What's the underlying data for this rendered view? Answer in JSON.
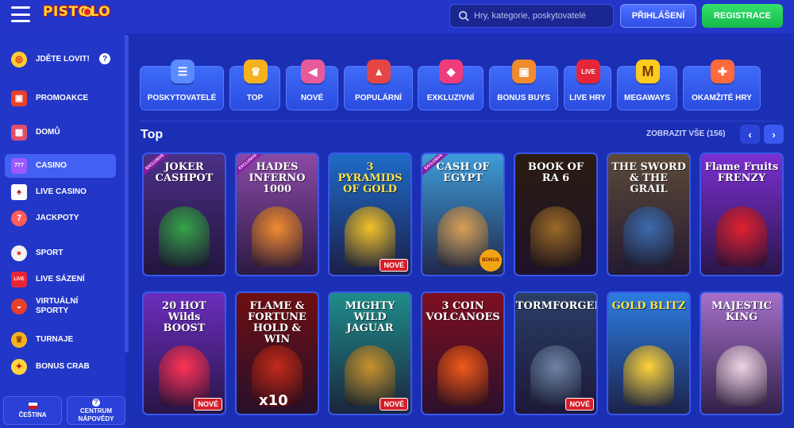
{
  "header": {
    "logo": "PISTOLO",
    "search_placeholder": "Hry, kategorie, poskytovatelé",
    "login_label": "PŘIHLÁŠENÍ",
    "register_label": "REGISTRACE"
  },
  "sidebar": {
    "items": [
      {
        "label": "JDĚTE LOVIT!",
        "icon": "target-icon",
        "color": "#ffcc33"
      },
      {
        "label": "PROMOAKCE",
        "icon": "gift-icon",
        "color": "#e8402b"
      },
      {
        "label": "DOMŮ",
        "icon": "slot-machine-icon",
        "color": "#e04f6a"
      },
      {
        "label": "CASINO",
        "icon": "casino-777-icon",
        "color": "#9b59ff"
      },
      {
        "label": "LIVE CASINO",
        "icon": "cards-icon",
        "color": "#ffffff"
      },
      {
        "label": "JACKPOTY",
        "icon": "jackpot-icon",
        "color": "#ff5c5c"
      },
      {
        "label": "SPORT",
        "icon": "ball-icon",
        "color": "#f2f2f2"
      },
      {
        "label": "LIVE SÁZENÍ",
        "icon": "live-icon",
        "color": "#e82538"
      },
      {
        "label": "VIRTUÁLNÍ SPORTY",
        "icon": "virtual-sports-icon",
        "color": "#e8402b"
      },
      {
        "label": "TURNAJE",
        "icon": "trophy-icon",
        "color": "#f5b21e"
      },
      {
        "label": "BONUS CRAB",
        "icon": "crab-icon",
        "color": "#ffd43d"
      }
    ],
    "language_label": "ČEŠTINA",
    "help_center_label": "CENTRUM NÁPOVĚDY"
  },
  "categories": [
    {
      "label": "POSKYTOVATELÉ",
      "icon": "providers-icon",
      "color": "#5a8bff"
    },
    {
      "label": "TOP",
      "icon": "crown-icon",
      "color": "#f5b21e"
    },
    {
      "label": "NOVÉ",
      "icon": "megaphone-icon",
      "color": "#e85a9b"
    },
    {
      "label": "POPULÁRNÍ",
      "icon": "rocket-icon",
      "color": "#e64545"
    },
    {
      "label": "EXKLUZIVNÍ",
      "icon": "diamond-icon",
      "color": "#f03c7a"
    },
    {
      "label": "BONUS BUYS",
      "icon": "gift-box-icon",
      "color": "#f08b2e"
    },
    {
      "label": "LIVE HRY",
      "icon": "live-tv-icon",
      "color": "#e82538"
    },
    {
      "label": "MEGAWAYS",
      "icon": "megaways-icon",
      "color": "#ffcb1f"
    },
    {
      "label": "OKAMŽITÉ HRY",
      "icon": "joystick-icon",
      "color": "#ff6a3c"
    }
  ],
  "section": {
    "title": "Top",
    "view_all": "ZOBRAZIT VŠE (156)"
  },
  "games": [
    {
      "title": "JOKER CASHPOT",
      "bg": "#4b2f86",
      "art": "#37a34a",
      "badge": "",
      "excl": "EXCLUSIVE"
    },
    {
      "title": "HADES INFERNO 1000",
      "bg": "#8a4aa6",
      "art": "#f08b2e",
      "badge": "",
      "excl": "EXCLUSIVE"
    },
    {
      "title": "3 PYRAMIDS OF GOLD",
      "bg": "#1f6bc9",
      "art": "#f3c128",
      "badge": "NOVÉ",
      "excl": ""
    },
    {
      "title": "CASH OF EGYPT",
      "bg": "#3e9cd8",
      "art": "#d9a057",
      "badge": "BONUS",
      "excl": "EXCLUSIVE"
    },
    {
      "title": "BOOK OF RA 6",
      "bg": "#2b1c10",
      "art": "#9a6a2a",
      "badge": "",
      "excl": ""
    },
    {
      "title": "THE SWORD & THE GRAIL",
      "bg": "#5b4a38",
      "art": "#3c6ab0",
      "badge": "",
      "excl": ""
    },
    {
      "title": "Flame Fruits FRENZY",
      "bg": "#7b2fd0",
      "art": "#e0212c",
      "badge": "",
      "excl": ""
    },
    {
      "title": "20 HOT Wilds BOOST",
      "bg": "#6b2dbd",
      "art": "#ff3355",
      "badge": "NOVÉ",
      "excl": ""
    },
    {
      "title": "FLAME & FORTUNE HOLD & WIN",
      "bg": "#6e0f12",
      "art": "#c22a1a",
      "badge": "x10",
      "excl": ""
    },
    {
      "title": "MIGHTY WILD JAGUAR",
      "bg": "#1e8d8a",
      "art": "#c8912e",
      "badge": "NOVÉ",
      "excl": ""
    },
    {
      "title": "3 COIN VOLCANOES",
      "bg": "#7e0f20",
      "art": "#f05a1a",
      "badge": "",
      "excl": ""
    },
    {
      "title": "STORMFORGED",
      "bg": "#2a3e66",
      "art": "#6d82a6",
      "badge": "NOVÉ",
      "excl": ""
    },
    {
      "title": "GOLD BLITZ",
      "bg": "#2b7de0",
      "art": "#ffd23a",
      "badge": "",
      "excl": ""
    },
    {
      "title": "MAJESTIC KING",
      "bg": "#a56fc9",
      "art": "#f0d4e4",
      "badge": "",
      "excl": ""
    }
  ]
}
